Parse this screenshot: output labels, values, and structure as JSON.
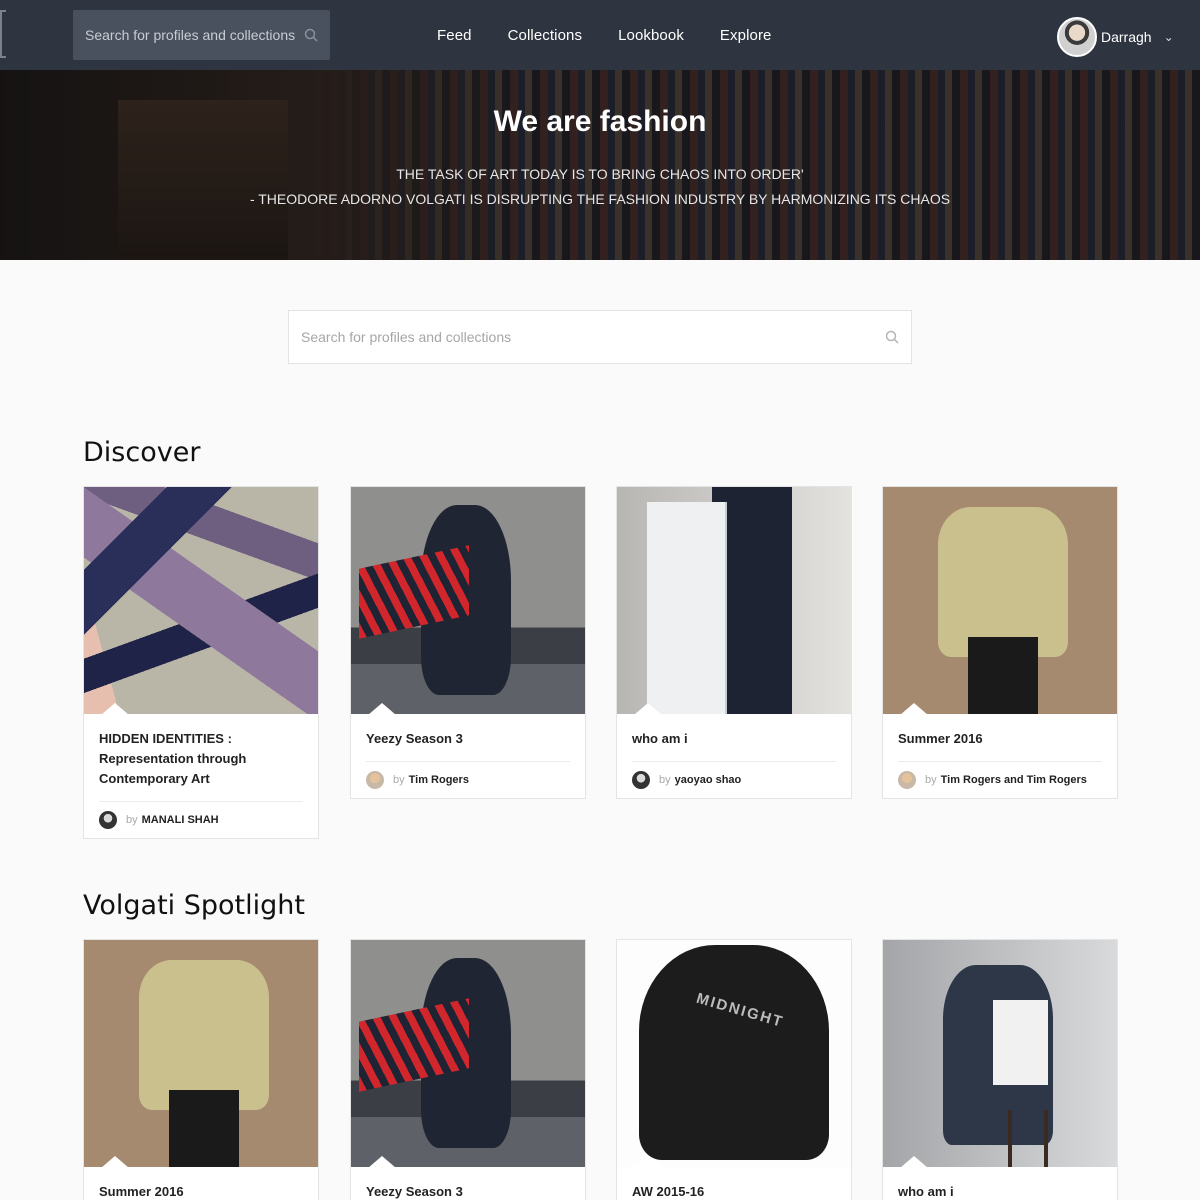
{
  "nav": {
    "search_placeholder": "Search for profiles and collections",
    "links": [
      "Feed",
      "Collections",
      "Lookbook",
      "Explore"
    ],
    "user_name": "Darragh"
  },
  "hero": {
    "title": "We are fashion",
    "quote_line1": "THE TASK OF ART TODAY IS TO BRING CHAOS INTO ORDER'",
    "quote_line2": "- THEODORE ADORNO VOLGATI IS DISRUPTING THE FASHION INDUSTRY BY HARMONIZING ITS CHAOS"
  },
  "search": {
    "placeholder": "Search for profiles and collections"
  },
  "discover": {
    "title": "Discover",
    "cards": [
      {
        "title": "HIDDEN IDENTITIES : Representation through Contemporary Art",
        "by": "by",
        "author": "MANALI SHAH"
      },
      {
        "title": "Yeezy Season 3",
        "by": "by",
        "author": "Tim Rogers"
      },
      {
        "title": "who am i",
        "by": "by",
        "author": "yaoyao shao"
      },
      {
        "title": "Summer 2016",
        "by": "by",
        "author": "Tim Rogers and Tim Rogers"
      }
    ]
  },
  "spotlight": {
    "title": "Volgati Spotlight",
    "cards": [
      {
        "title": "Summer 2016"
      },
      {
        "title": "Yeezy Season 3"
      },
      {
        "title": "AW 2015-16",
        "print": "MIDNIGHT"
      },
      {
        "title": "who am i"
      }
    ]
  },
  "icons": {
    "search": "search-icon",
    "chevron": "chevron-down-icon"
  }
}
